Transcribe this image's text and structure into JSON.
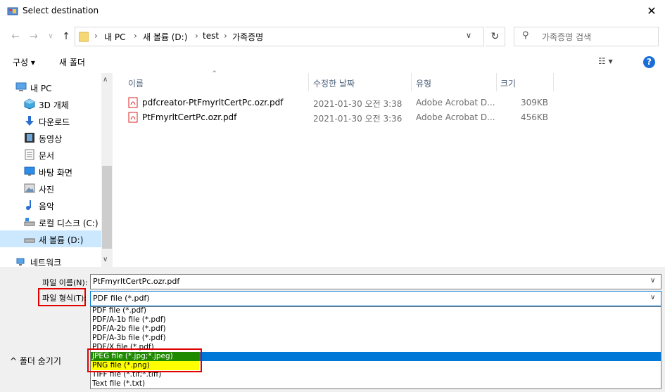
{
  "window": {
    "title": "Select destination"
  },
  "address": {
    "crumbs": [
      "내 PC",
      "새 볼륨 (D:)",
      "test",
      "가족증명"
    ],
    "search_placeholder": "가족증명 검색"
  },
  "toolbar": {
    "organize": "구성 ▾",
    "new_folder": "새 폴더"
  },
  "nav": {
    "items": [
      {
        "label": "내 PC",
        "icon": "computer-icon"
      },
      {
        "label": "3D 개체",
        "icon": "cube-icon"
      },
      {
        "label": "다운로드",
        "icon": "download-icon"
      },
      {
        "label": "동영상",
        "icon": "video-icon"
      },
      {
        "label": "문서",
        "icon": "document-icon"
      },
      {
        "label": "바탕 화면",
        "icon": "desktop-icon"
      },
      {
        "label": "사진",
        "icon": "picture-icon"
      },
      {
        "label": "음악",
        "icon": "music-icon"
      },
      {
        "label": "로컬 디스크 (C:)",
        "icon": "drive-icon"
      },
      {
        "label": "새 볼륨 (D:)",
        "icon": "drive-icon",
        "selected": true
      },
      {
        "label": "네트워크",
        "icon": "network-icon"
      }
    ]
  },
  "columns": {
    "name": "이름",
    "date": "수정한 날짜",
    "type": "유형",
    "size": "크기"
  },
  "files": [
    {
      "name": "pdfcreator-PtFmyrltCertPc.ozr.pdf",
      "date": "2021-01-30 오전 3:38",
      "type": "Adobe Acrobat D...",
      "size": "309KB"
    },
    {
      "name": "PtFmyrltCertPc.ozr.pdf",
      "date": "2021-01-30 오전 3:36",
      "type": "Adobe Acrobat D...",
      "size": "456KB"
    }
  ],
  "form": {
    "filename_label": "파일 이름(N):",
    "filename_value": "PtFmyrltCertPc.ozr.pdf",
    "filetype_label": "파일 형식(T):",
    "filetype_value": "PDF file (*.pdf)"
  },
  "filetype_options": [
    "PDF file (*.pdf)",
    "PDF/A-1b file (*.pdf)",
    "PDF/A-2b file (*.pdf)",
    "PDF/A-3b file (*.pdf)",
    "PDF/X file (*.pdf)",
    "JPEG file (*.jpg;*.jpeg)",
    "PNG file (*.png)",
    "TIFF file (*.tif;*.tiff)",
    "Text file (*.txt)"
  ],
  "hide_folders": "^  폴더 숨기기",
  "colors": {
    "accent": "#0078d7",
    "highlight_green": "#1f8a00",
    "highlight_yellow": "#ffff00",
    "annotation_red": "#e20000"
  }
}
